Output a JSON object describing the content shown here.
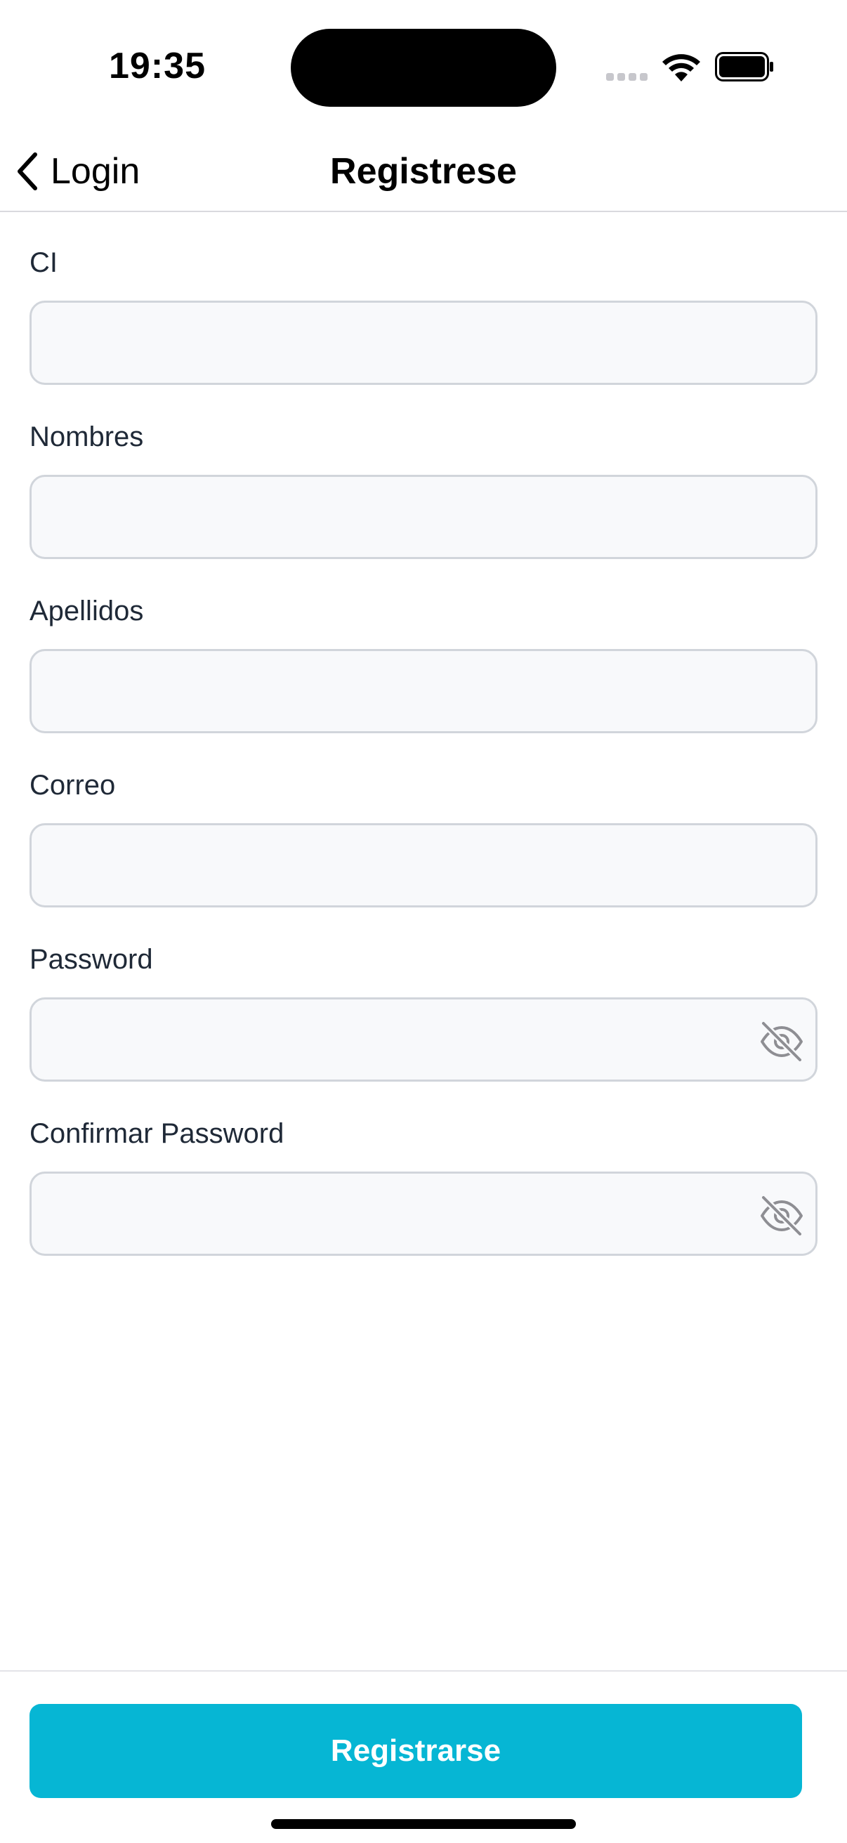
{
  "status_bar": {
    "time": "19:35"
  },
  "nav": {
    "back_label": "Login",
    "title": "Registrese"
  },
  "form": {
    "fields": [
      {
        "label": "CI",
        "value": "",
        "type": "text"
      },
      {
        "label": "Nombres",
        "value": "",
        "type": "text"
      },
      {
        "label": "Apellidos",
        "value": "",
        "type": "text"
      },
      {
        "label": "Correo",
        "value": "",
        "type": "email"
      },
      {
        "label": "Password",
        "value": "",
        "type": "password",
        "icon": "eye-off-icon"
      },
      {
        "label": "Confirmar Password",
        "value": "",
        "type": "password",
        "icon": "eye-off-icon"
      }
    ]
  },
  "footer": {
    "submit_label": "Registrarse"
  },
  "colors": {
    "accent": "#06b6d4",
    "input_background": "#f8f9fb",
    "input_border": "#d1d5db"
  }
}
